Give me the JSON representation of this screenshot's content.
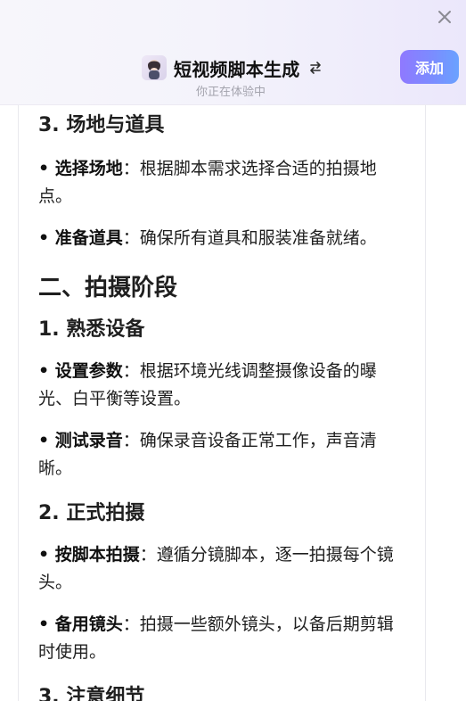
{
  "header": {
    "title": "短视频脚本生成",
    "subtitle": "你正在体验中",
    "add_label": "添加",
    "icons": {
      "close": "close-icon",
      "switch": "switch-arrows-icon",
      "avatar": "avatar"
    }
  },
  "content": {
    "blocks": [
      {
        "type": "h3",
        "text": "3. 场地与道具"
      },
      {
        "type": "item",
        "bold": "• 选择场地",
        "text": "：根据脚本需求选择合适的拍摄地点。"
      },
      {
        "type": "item",
        "bold": "• 准备道具",
        "text": "：确保所有道具和服装准备就绪。"
      },
      {
        "type": "h2",
        "text": "二、拍摄阶段"
      },
      {
        "type": "h3",
        "text": "1. 熟悉设备"
      },
      {
        "type": "item",
        "bold": "• 设置参数",
        "text": "：根据环境光线调整摄像设备的曝光、白平衡等设置。"
      },
      {
        "type": "item",
        "bold": "• 测试录音",
        "text": "：确保录音设备正常工作，声音清晰。"
      },
      {
        "type": "h3",
        "text": "2. 正式拍摄"
      },
      {
        "type": "item",
        "bold": "• 按脚本拍摄",
        "text": "：遵循分镜脚本，逐一拍摄每个镜头。"
      },
      {
        "type": "item",
        "bold": "• 备用镜头",
        "text": "：拍摄一些额外镜头，以备后期剪辑时使用。"
      },
      {
        "type": "h3",
        "text": "3. 注意细节"
      }
    ]
  },
  "colors": {
    "accent_start": "#8f79ff",
    "accent_end": "#6aa2ff",
    "text": "#1f1f1f",
    "subtext": "#a3a3ad"
  }
}
